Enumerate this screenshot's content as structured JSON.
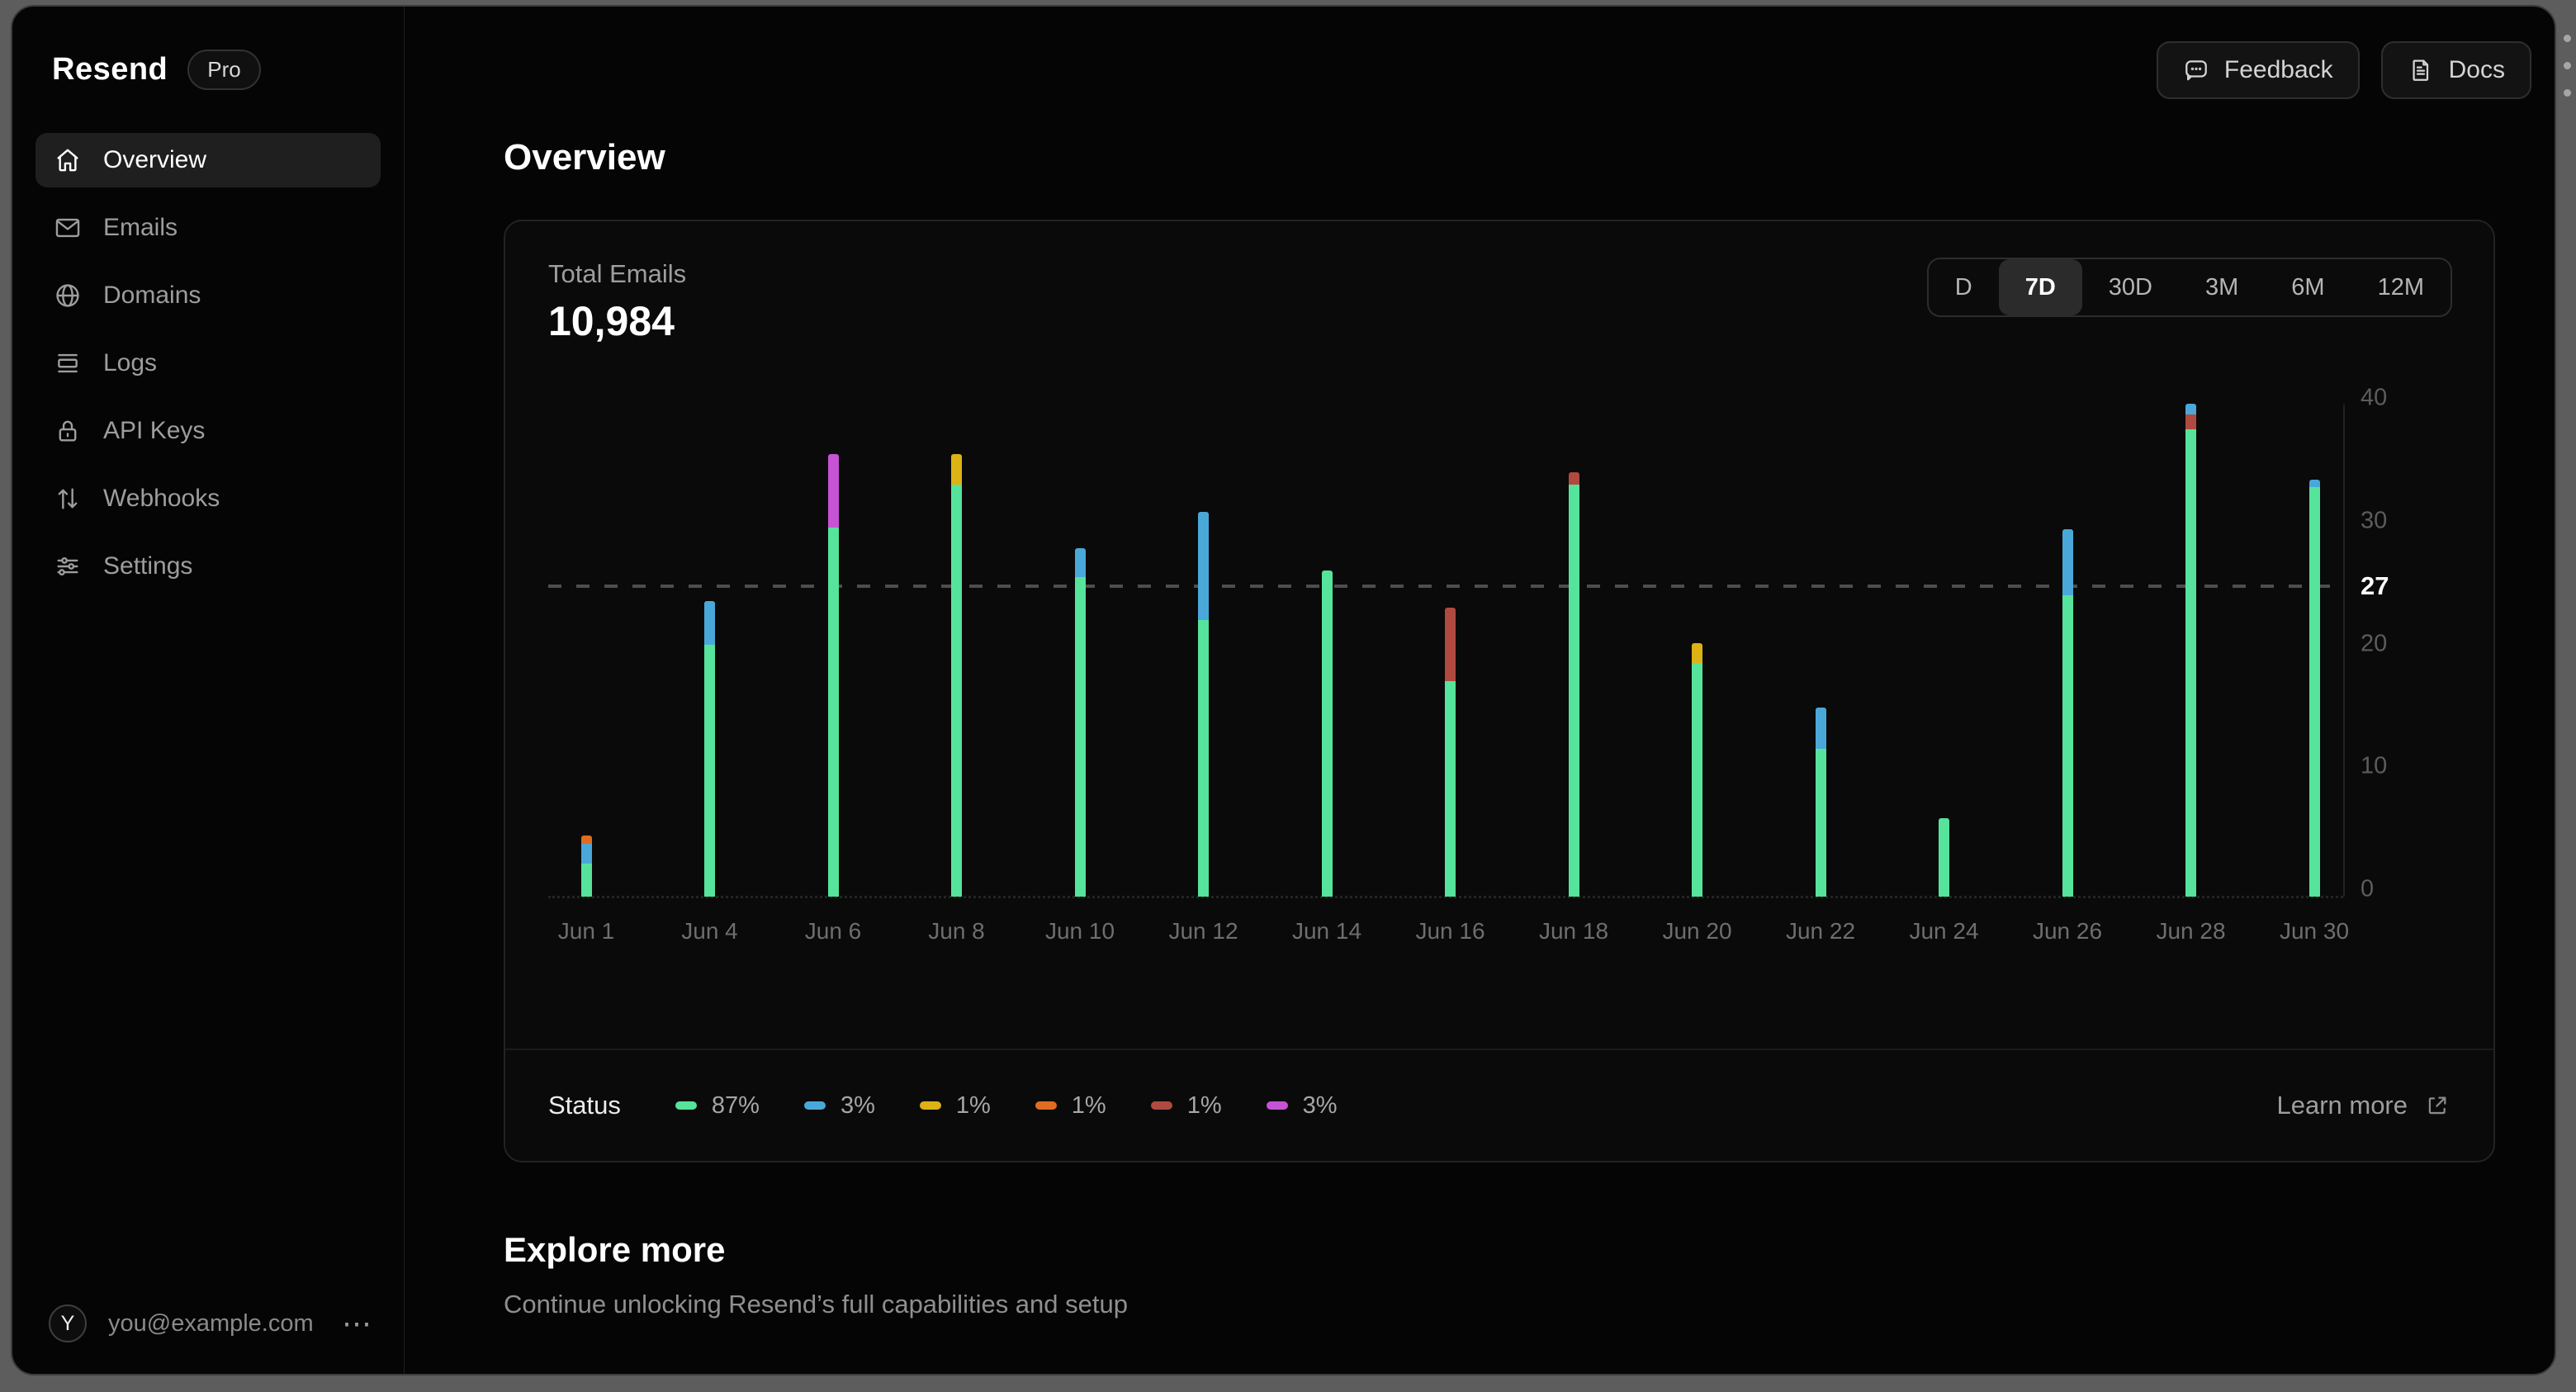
{
  "sidebar": {
    "logo": "Resend",
    "badge": "Pro",
    "items": [
      {
        "label": "Overview",
        "icon": "home-icon",
        "active": true
      },
      {
        "label": "Emails",
        "icon": "mail-icon",
        "active": false
      },
      {
        "label": "Domains",
        "icon": "globe-icon",
        "active": false
      },
      {
        "label": "Logs",
        "icon": "logs-icon",
        "active": false
      },
      {
        "label": "API Keys",
        "icon": "lock-icon",
        "active": false
      },
      {
        "label": "Webhooks",
        "icon": "arrows-up-down-icon",
        "active": false
      },
      {
        "label": "Settings",
        "icon": "sliders-icon",
        "active": false
      }
    ],
    "user": {
      "initial": "Y",
      "email": "you@example.com",
      "menu": "⋯"
    }
  },
  "header": {
    "feedback_label": "Feedback",
    "docs_label": "Docs"
  },
  "page": {
    "title": "Overview"
  },
  "card": {
    "metric_label": "Total Emails",
    "metric_value": "10,984",
    "ranges": [
      {
        "label": "D",
        "active": false
      },
      {
        "label": "7D",
        "active": true
      },
      {
        "label": "30D",
        "active": false
      },
      {
        "label": "3M",
        "active": false
      },
      {
        "label": "6M",
        "active": false
      },
      {
        "label": "12M",
        "active": false
      }
    ],
    "status_label": "Status",
    "learn_more_label": "Learn more"
  },
  "chart_data": {
    "type": "bar",
    "stacked": true,
    "title": "Total Emails",
    "ylim": [
      0,
      40
    ],
    "yticks": [
      40,
      30,
      20,
      10,
      0
    ],
    "marker_value": 27,
    "grid": false,
    "legend_position": "bottom",
    "colors": {
      "green": "#56e39b",
      "blue": "#4aa8d8",
      "yellow": "#dcb214",
      "orange": "#e06c1f",
      "red": "#b04a40",
      "magenta": "#c653d4"
    },
    "legend": [
      {
        "color": "green",
        "percent": "87%"
      },
      {
        "color": "blue",
        "percent": "3%"
      },
      {
        "color": "yellow",
        "percent": "1%"
      },
      {
        "color": "orange",
        "percent": "1%"
      },
      {
        "color": "red",
        "percent": "1%"
      },
      {
        "color": "magenta",
        "percent": "3%"
      }
    ],
    "bars": [
      {
        "label": "Jun 1",
        "segments": [
          [
            "green",
            2.7
          ],
          [
            "blue",
            1.6
          ],
          [
            "orange",
            0.7
          ]
        ]
      },
      {
        "label": "Jun 4",
        "segments": [
          [
            "green",
            20.5
          ],
          [
            "blue",
            3.5
          ]
        ]
      },
      {
        "label": "Jun 6",
        "segments": [
          [
            "green",
            30
          ],
          [
            "magenta",
            6
          ]
        ]
      },
      {
        "label": "Jun 8",
        "segments": [
          [
            "green",
            33.5
          ],
          [
            "yellow",
            2.5
          ]
        ]
      },
      {
        "label": "Jun 10",
        "segments": [
          [
            "green",
            26
          ],
          [
            "blue",
            2.3
          ]
        ]
      },
      {
        "label": "Jun 12",
        "segments": [
          [
            "green",
            22.5
          ],
          [
            "blue",
            8.8
          ]
        ]
      },
      {
        "label": "Jun 14",
        "segments": [
          [
            "green",
            26.5
          ]
        ]
      },
      {
        "label": "Jun 16",
        "segments": [
          [
            "green",
            17.5
          ],
          [
            "red",
            6
          ]
        ]
      },
      {
        "label": "Jun 18",
        "segments": [
          [
            "green",
            33.5
          ],
          [
            "red",
            1
          ]
        ]
      },
      {
        "label": "Jun 20",
        "segments": [
          [
            "green",
            19
          ],
          [
            "yellow",
            1.6
          ]
        ]
      },
      {
        "label": "Jun 22",
        "segments": [
          [
            "green",
            12
          ],
          [
            "blue",
            3.4
          ]
        ]
      },
      {
        "label": "Jun 24",
        "segments": [
          [
            "green",
            6.4
          ]
        ]
      },
      {
        "label": "Jun 26",
        "segments": [
          [
            "green",
            24.5
          ],
          [
            "blue",
            5.4
          ]
        ]
      },
      {
        "label": "Jun 28",
        "segments": [
          [
            "green",
            38
          ],
          [
            "red",
            1.2
          ],
          [
            "blue",
            0.9
          ]
        ]
      },
      {
        "label": "Jun 30",
        "segments": [
          [
            "green",
            33.3
          ],
          [
            "blue",
            0.6
          ]
        ]
      }
    ]
  },
  "explore": {
    "title": "Explore more",
    "subtitle": "Continue unlocking Resend’s full capabilities and setup"
  }
}
